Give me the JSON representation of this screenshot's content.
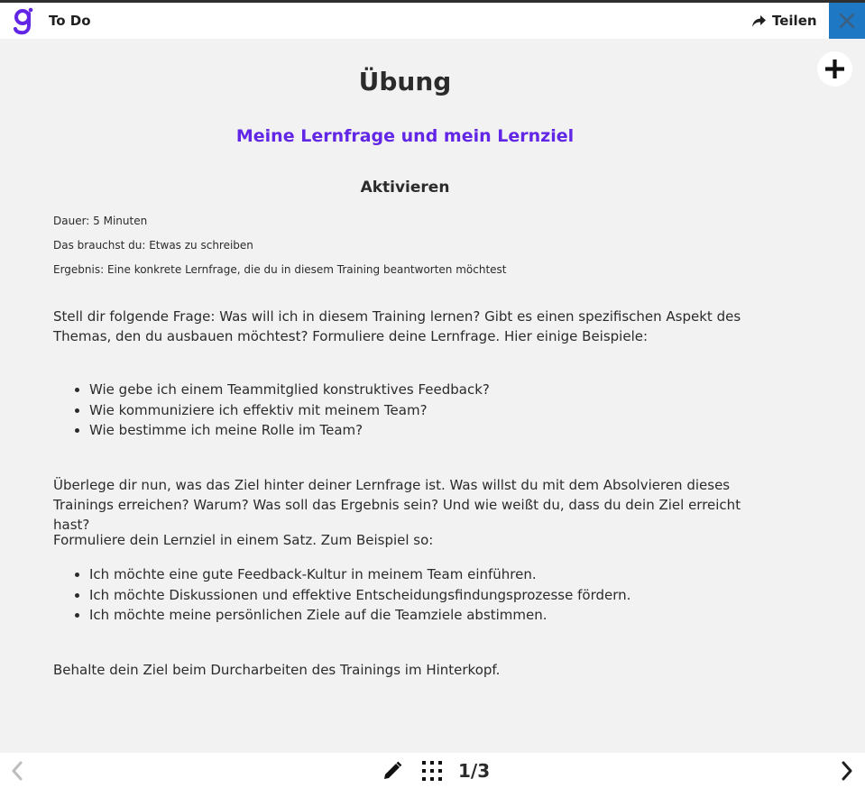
{
  "app": {
    "title": "To Do",
    "accent_color": "#6226e6",
    "close_color": "#1e78c4"
  },
  "toolbar": {
    "share_label": "Teilen",
    "share_icon": "share-arrow-icon",
    "close_icon": "close-icon",
    "add_icon": "plus-icon"
  },
  "content": {
    "title": "Übung",
    "subtitle": "Meine Lernfrage und mein Lernziel",
    "section_title": "Aktivieren",
    "meta": [
      "Dauer: 5 Minuten",
      "Das brauchst du: Etwas zu schreiben",
      "Ergebnis: Eine konkrete Lernfrage, die du in diesem Training beantworten möchtest"
    ],
    "intro_paragraph": "Stell dir folgende Frage: Was will ich in diesem Training lernen? Gibt es einen spezifischen Aspekt des Themas, den du ausbauen möchtest? Formuliere deine Lernfrage. Hier einige Beispiele:",
    "question_examples": [
      "Wie gebe ich einem Teammitglied konstruktives Feedback?",
      "Wie kommuniziere ich effektiv mit meinem Team?",
      "Wie bestimme ich meine Rolle im Team?"
    ],
    "goal_paragraph": "Überlege dir nun, was das Ziel hinter deiner Lernfrage ist. Was willst du mit dem Absolvieren dieses Trainings erreichen? Warum? Was soll das Ergebnis sein? Und wie weißt du, dass du dein Ziel erreicht hast?",
    "goal_instruction": "Formuliere dein Lernziel in einem Satz. Zum Beispiel so:",
    "goal_examples": [
      "Ich möchte eine gute Feedback-Kultur in meinem Team einführen.",
      "Ich möchte Diskussionen und effektive Entscheidungsfindungsprozesse fördern.",
      "Ich möchte meine persönlichen Ziele auf die Teamziele abstimmen."
    ],
    "closing_paragraph": "Behalte dein Ziel beim Durcharbeiten des Trainings im Hinterkopf."
  },
  "footer": {
    "page_indicator": "1/3",
    "prev_icon": "chevron-left-icon",
    "next_icon": "chevron-right-icon",
    "edit_icon": "pencil-icon",
    "grid_icon": "grid-icon"
  }
}
